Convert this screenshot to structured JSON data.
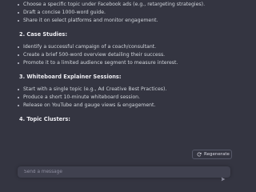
{
  "messages": {
    "sections": [
      {
        "heading": "",
        "items": [
          "Choose a specific topic under Facebook ads (e.g., retargeting strategies).",
          "Draft a concise 1000-word guide.",
          "Share it on select platforms and monitor engagement."
        ]
      },
      {
        "heading": "2. Case Studies:",
        "items": [
          "Identify a successful campaign of a coach/consultant.",
          "Create a brief 500-word overview detailing their success.",
          "Promote it to a limited audience segment to measure interest."
        ]
      },
      {
        "heading": "3. Whiteboard Explainer Sessions:",
        "items": [
          "Start with a single topic (e.g., Ad Creative Best Practices).",
          "Produce a short 10-minute whiteboard session.",
          "Release on YouTube and gauge views & engagement."
        ]
      },
      {
        "heading": "4. Topic Clusters:",
        "items": []
      }
    ]
  },
  "regenerate": {
    "label": "Regenerate",
    "icon": "refresh-icon"
  },
  "composer": {
    "placeholder": "Send a message",
    "send_icon": "send-icon"
  },
  "colors": {
    "background": "#343541",
    "text": "#d1d5db",
    "composer_bg": "#40414f"
  }
}
